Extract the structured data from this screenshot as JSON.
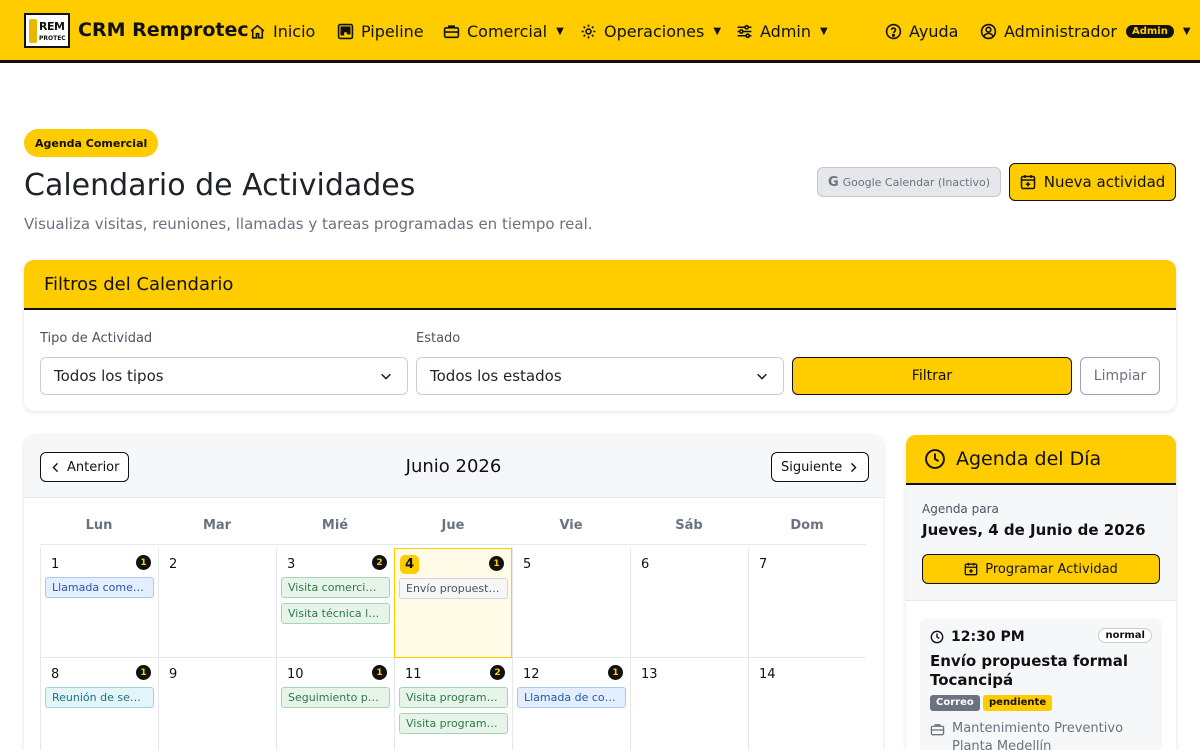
{
  "navbar": {
    "logo_text_top": "REM",
    "logo_text_bottom": "PROTEC",
    "brand": "CRM Remprotec",
    "items": [
      {
        "label": "Inicio",
        "icon": "home-icon"
      },
      {
        "label": "Pipeline",
        "icon": "kanban-icon"
      },
      {
        "label": "Comercial",
        "icon": "briefcase-icon"
      },
      {
        "label": "Operaciones",
        "icon": "gear-icon"
      },
      {
        "label": "Admin",
        "icon": "sliders-icon"
      }
    ],
    "help_label": "Ayuda",
    "user_label": "Administrador",
    "user_badge": "Admin"
  },
  "header": {
    "section_pill": "Agenda Comercial",
    "title": "Calendario de Actividades",
    "subtitle": "Visualiza visitas, reuniones, llamadas y tareas programadas en tiempo real.",
    "gcal_label": "Google Calendar (Inactivo)",
    "new_activity_label": "Nueva actividad"
  },
  "filters": {
    "title": "Filtros del Calendario",
    "type_label": "Tipo de Actividad",
    "type_value": "Todos los tipos",
    "status_label": "Estado",
    "status_value": "Todos los estados",
    "filter_button": "Filtrar",
    "clear_button": "Limpiar"
  },
  "calendar": {
    "prev_label": "Anterior",
    "next_label": "Siguiente",
    "month_title": "Junio 2026",
    "weekdays": [
      "Lun",
      "Mar",
      "Mié",
      "Jue",
      "Vie",
      "Sáb",
      "Dom"
    ],
    "days": [
      {
        "num": "1",
        "count": "1",
        "events": [
          {
            "label": "Llamada comercial",
            "color": "blue"
          }
        ]
      },
      {
        "num": "2",
        "count": "",
        "events": []
      },
      {
        "num": "3",
        "count": "2",
        "events": [
          {
            "label": "Visita comercial programada",
            "color": "green"
          },
          {
            "label": "Visita técnica levantamiento",
            "color": "green"
          }
        ]
      },
      {
        "num": "4",
        "count": "1",
        "today": true,
        "events": [
          {
            "label": "Envío propuesta formal",
            "color": "gray"
          }
        ]
      },
      {
        "num": "5",
        "count": "",
        "events": []
      },
      {
        "num": "6",
        "count": "",
        "events": []
      },
      {
        "num": "7",
        "count": "",
        "events": []
      },
      {
        "num": "8",
        "count": "1",
        "events": [
          {
            "label": "Reunión de seguimiento",
            "color": "cyan"
          }
        ]
      },
      {
        "num": "9",
        "count": "",
        "events": []
      },
      {
        "num": "10",
        "count": "1",
        "events": [
          {
            "label": "Seguimiento por correo",
            "color": "green"
          }
        ]
      },
      {
        "num": "11",
        "count": "2",
        "events": [
          {
            "label": "Visita programada",
            "color": "green"
          },
          {
            "label": "Visita programada",
            "color": "green"
          }
        ]
      },
      {
        "num": "12",
        "count": "1",
        "events": [
          {
            "label": "Llamada de cobro",
            "color": "blue"
          }
        ]
      },
      {
        "num": "13",
        "count": "",
        "events": []
      },
      {
        "num": "14",
        "count": "",
        "events": []
      }
    ]
  },
  "agenda": {
    "title": "Agenda del Día",
    "for_label": "Agenda para",
    "date": "Jueves, 4 de Junio de 2026",
    "program_button": "Programar Actividad",
    "items": [
      {
        "time": "12:30 PM",
        "priority": "normal",
        "title": "Envío propuesta formal Tocancipá",
        "type_tag": "Correo",
        "status_tag": "pendiente",
        "client": "Mantenimiento Preventivo Planta Medellín"
      }
    ]
  },
  "colors": {
    "brand_yellow": "#ffcc00",
    "dark": "#111111"
  }
}
